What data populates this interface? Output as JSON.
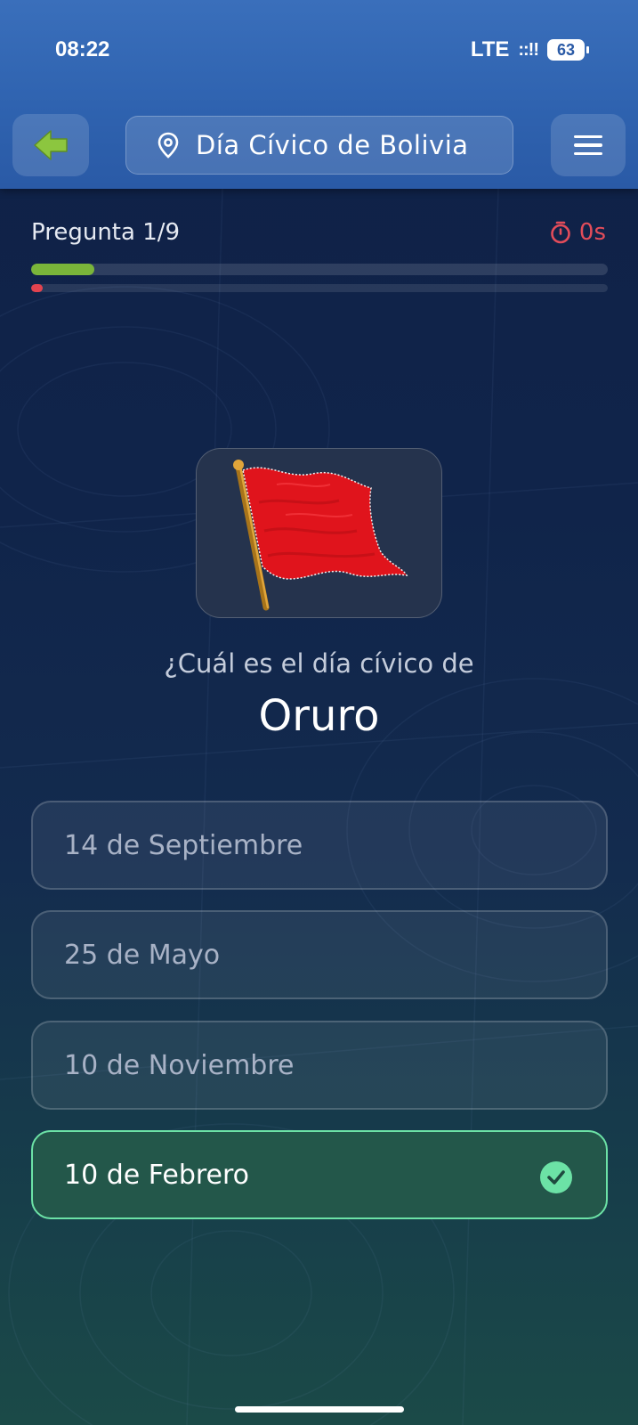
{
  "status_bar": {
    "time": "08:22",
    "network": "LTE",
    "signal": "::!!",
    "battery": "63"
  },
  "header": {
    "back_icon": "arrow-left-icon",
    "location_icon": "map-pin-icon",
    "title": "Día Cívico de Bolivia",
    "menu_icon": "hamburger-menu-icon"
  },
  "quiz": {
    "question_counter": "Pregunta 1/9",
    "timer": "0s",
    "timer_icon": "stopwatch-icon",
    "progress": 0.11,
    "time_elapsed": 0.02,
    "prompt": "¿Cuál es el día cívico de",
    "subject": "Oruro",
    "image": "red-flag-image",
    "options": [
      {
        "label": "14 de Septiembre",
        "state": "default"
      },
      {
        "label": "25 de Mayo",
        "state": "default"
      },
      {
        "label": "10 de Noviembre",
        "state": "default"
      },
      {
        "label": "10 de Febrero",
        "state": "correct"
      }
    ],
    "correct_icon": "check-circle-icon"
  },
  "colors": {
    "accent_green": "#7ab53a",
    "correct_border": "#6ce2a6",
    "timer_red": "#e24c5a",
    "header_blue": "#2f63b0"
  }
}
